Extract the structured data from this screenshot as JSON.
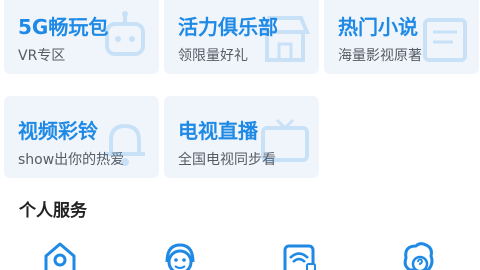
{
  "cards": [
    {
      "title": "5G畅玩包",
      "subtitle": "VR专区",
      "icon": "robot-icon"
    },
    {
      "title": "活力俱乐部",
      "subtitle": "领限量好礼",
      "icon": "shop-icon"
    },
    {
      "title": "热门小说",
      "subtitle": "海量影视原著",
      "icon": "book-icon"
    },
    {
      "title": "视频彩铃",
      "subtitle": "show出你的热爱",
      "icon": "bell-icon"
    },
    {
      "title": "电视直播",
      "subtitle": "全国电视同步看",
      "icon": "live-tv-icon"
    }
  ],
  "personal_services": {
    "title": "个人服务",
    "icons": [
      "home-account-icon",
      "customer-service-icon",
      "broadband-icon",
      "help-icon"
    ]
  },
  "colors": {
    "accent": "#1f8ae6",
    "card_bg": "#f0f5fb",
    "text_secondary": "#555c66"
  }
}
